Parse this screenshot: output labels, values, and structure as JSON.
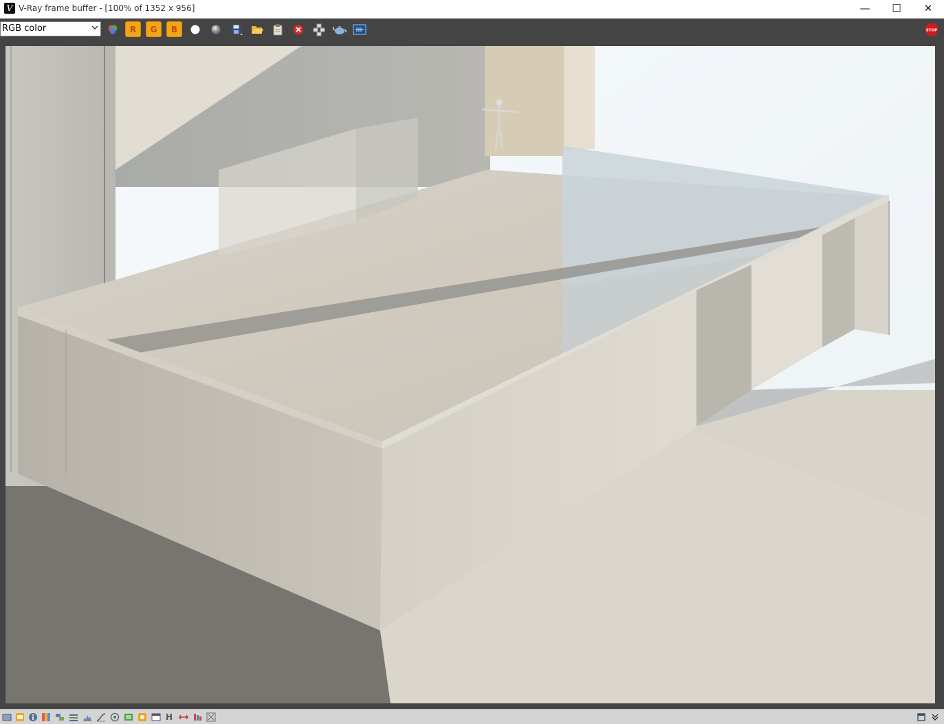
{
  "window": {
    "title": "V-Ray frame buffer - [100% of 1352 x 956]",
    "app_icon_glyph": "V",
    "controls": {
      "minimize": "—",
      "maximize": "☐",
      "close": "✕"
    }
  },
  "toolbar": {
    "channel_selected": "RGB color",
    "channel_buttons": {
      "red": "R",
      "green": "G",
      "blue": "B"
    },
    "icons": [
      "rgb-channels-icon",
      "red-channel-icon",
      "green-channel-icon",
      "blue-channel-icon",
      "white-sphere-icon",
      "mono-sphere-icon",
      "save-image-icon",
      "open-folder-icon",
      "clipboard-icon",
      "clear-image-icon",
      "region-render-icon",
      "teapot-render-icon",
      "vray-log-icon",
      "stop-render-icon"
    ],
    "stop_label": "STOP"
  },
  "colors": {
    "toolbar_bg": "#444444",
    "channel_button_bg": "#f3a41a",
    "stop_red": "#d21c1c",
    "statusbar_bg": "#d4d4d4"
  },
  "statusbar": {
    "h_label": "H",
    "icons": [
      "frame-icon",
      "history-icon",
      "info-icon",
      "color-correction-icon",
      "layers-icon",
      "lut-icon",
      "histogram-icon",
      "curves-icon",
      "lens-icon",
      "display-icon",
      "settings-icon",
      "window-icon",
      "h-icon",
      "stereo-icon",
      "pan-icon",
      "compare-icon",
      "expand-icon",
      "collapse-icon"
    ]
  }
}
